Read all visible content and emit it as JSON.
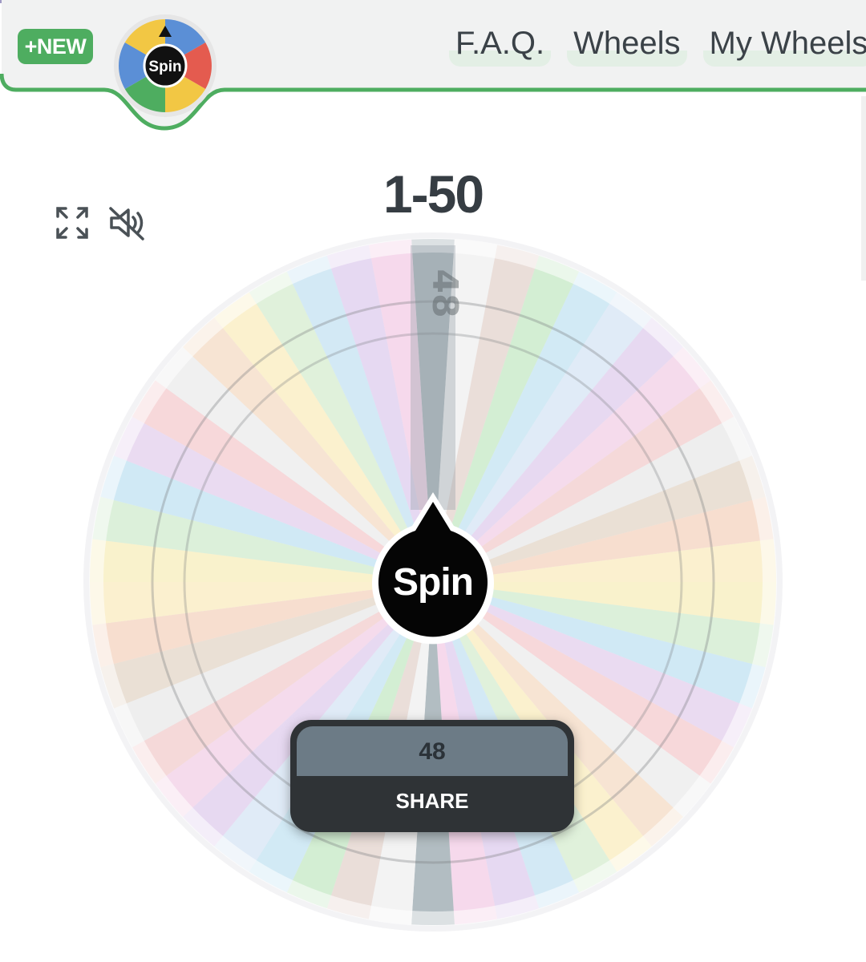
{
  "header": {
    "new_button_label": "+NEW",
    "logo_text": "Spin",
    "nav": [
      "F.A.Q.",
      "Wheels",
      "My Wheels"
    ],
    "accent_color": "#4ead60"
  },
  "page_title": "1-50",
  "toolbar": {
    "fullscreen_icon": "fullscreen-icon",
    "mute_icon": "sound-muted-icon"
  },
  "wheel": {
    "center_label": "Spin",
    "pointer_value": "48",
    "segment_colors": [
      "#a6b3b9",
      "#f2f2f2",
      "#e8d9d3",
      "#cdeccc",
      "#cbe8f5",
      "#dce9f7",
      "#e4d3f0",
      "#f4d6ea",
      "#f5d3d3",
      "#ececec",
      "#e7dccf",
      "#f7d9c8",
      "#fbeec8",
      "#f9f1c4",
      "#d7efd5",
      "#c9e6f4",
      "#e8d6f0",
      "#f7d2d5",
      "#eeeeee",
      "#f7e0cc",
      "#fbf0c7",
      "#dcf0d6",
      "#cde6f4",
      "#e3d4f1",
      "#f6d4ea"
    ]
  },
  "result": {
    "value": "48",
    "share_label": "SHARE"
  }
}
